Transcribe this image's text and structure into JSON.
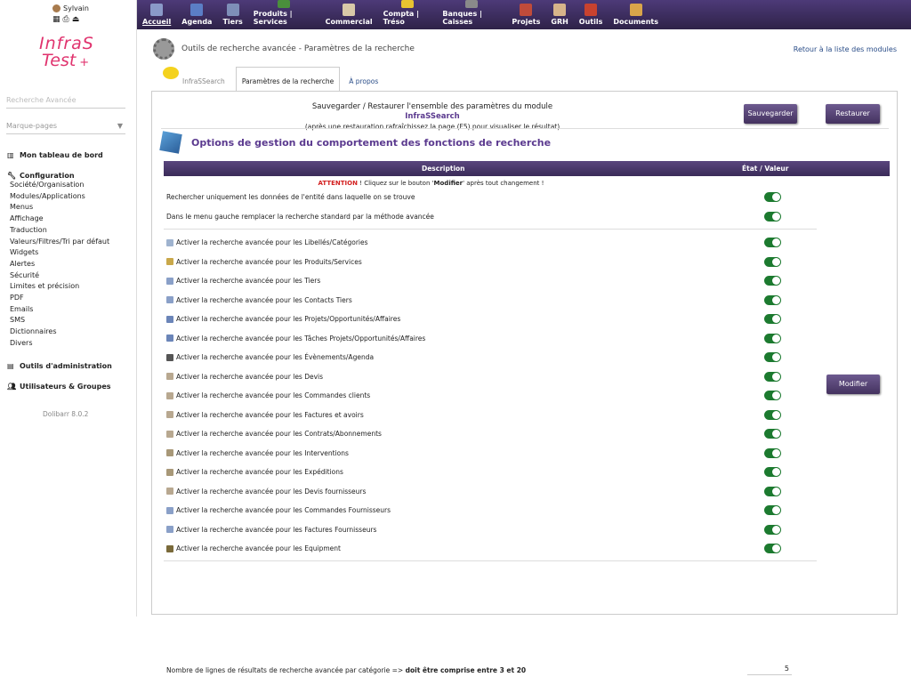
{
  "user": {
    "name": "Sylvain"
  },
  "logo": {
    "line1": "InfraS",
    "line2": "Test",
    "mark": "+"
  },
  "sidebar": {
    "search_placeholder": "Recherche Avancée",
    "bookmarks_placeholder": "Marque-pages",
    "dashboard": "Mon tableau de bord",
    "config_title": "Configuration",
    "config_items": [
      "Société/Organisation",
      "Modules/Applications",
      "Menus",
      "Affichage",
      "Traduction",
      "Valeurs/Filtres/Tri par défaut",
      "Widgets",
      "Alertes",
      "Sécurité",
      "Limites et précision",
      "PDF",
      "Emails",
      "SMS",
      "Dictionnaires",
      "Divers"
    ],
    "admin_tools": "Outils d'administration",
    "users_groups": "Utilisateurs & Groupes",
    "version": "Dolibarr 8.0.2"
  },
  "topmenu": [
    {
      "label": "Accueil",
      "color": "#8a9ac8"
    },
    {
      "label": "Agenda",
      "color": "#5b7ec6"
    },
    {
      "label": "Tiers",
      "color": "#7e8fb8"
    },
    {
      "label": "Produits | Services",
      "color": "#4a8f3c"
    },
    {
      "label": "Commercial",
      "color": "#d9c9a8"
    },
    {
      "label": "Compta | Tréso",
      "color": "#e8c330"
    },
    {
      "label": "Banques | Caisses",
      "color": "#8a8a8a"
    },
    {
      "label": "Projets",
      "color": "#c04b3a"
    },
    {
      "label": "GRH",
      "color": "#d7b48a"
    },
    {
      "label": "Outils",
      "color": "#c8422f"
    },
    {
      "label": "Documents",
      "color": "#d9a54a"
    }
  ],
  "page": {
    "title": "Outils de recherche avancée - Paramètres de la recherche",
    "back_link": "Retour à la liste des modules"
  },
  "tabs": [
    "InfraSSearch",
    "Paramètres de la recherche",
    "À propos"
  ],
  "savebar": {
    "line1_pre": "Sauvegarder / Restaurer l'ensemble des paramètres du module ",
    "module": "InfraSSearch",
    "line2": "(après une restauration rafraîchissez la page (F5) pour visualiser le résultat)",
    "save_label": "Sauvegarder",
    "restore_label": "Restaurer"
  },
  "section_title": "Options de gestion du comportement des fonctions de recherche",
  "table": {
    "col_desc": "Description",
    "col_state": "État / Valeur",
    "warn_label": "ATTENTION",
    "warn_pre": " ! Cliquez sur le bouton '",
    "warn_btn": "Modifier",
    "warn_post": "' après tout changement !",
    "general": [
      "Rechercher uniquement les données de l'entité dans laquelle on se trouve",
      "Dans le menu gauche remplacer la recherche standard par la méthode avancée"
    ],
    "items": [
      {
        "label": "Activer la recherche avancée pour les Libellés/Catégories",
        "icon": "#9fb3cf"
      },
      {
        "label": "Activer la recherche avancée pour les Produits/Services",
        "icon": "#c9a84a"
      },
      {
        "label": "Activer la recherche avancée pour les Tiers",
        "icon": "#8aa0c8"
      },
      {
        "label": "Activer la recherche avancée pour les Contacts Tiers",
        "icon": "#8aa0c8"
      },
      {
        "label": "Activer la recherche avancée pour les Projets/Opportunités/Affaires",
        "icon": "#6b85b8"
      },
      {
        "label": "Activer la recherche avancée pour les Tâches Projets/Opportunités/Affaires",
        "icon": "#6b85b8"
      },
      {
        "label": "Activer la recherche avancée pour les Évènements/Agenda",
        "icon": "#555555"
      },
      {
        "label": "Activer la recherche avancée pour les Devis",
        "icon": "#b8a890"
      },
      {
        "label": "Activer la recherche avancée pour les Commandes clients",
        "icon": "#b8a890"
      },
      {
        "label": "Activer la recherche avancée pour les Factures et avoirs",
        "icon": "#b8a890"
      },
      {
        "label": "Activer la recherche avancée pour les Contrats/Abonnements",
        "icon": "#b8a890"
      },
      {
        "label": "Activer la recherche avancée pour les Interventions",
        "icon": "#a89878"
      },
      {
        "label": "Activer la recherche avancée pour les Expéditions",
        "icon": "#a89878"
      },
      {
        "label": "Activer la recherche avancée pour les Devis fournisseurs",
        "icon": "#b8a890"
      },
      {
        "label": "Activer la recherche avancée pour les Commandes Fournisseurs",
        "icon": "#8aa0c8"
      },
      {
        "label": "Activer la recherche avancée pour les Factures Fournisseurs",
        "icon": "#8aa0c8"
      },
      {
        "label": "Activer la recherche avancée pour les Equipment",
        "icon": "#7a6a3a"
      }
    ],
    "modify_label": "Modifier",
    "footer_pre": "Nombre de lignes de résultats de recherche avancée par catégorie => ",
    "footer_bold": "doit être comprise entre 3 et 20",
    "footer_value": "5"
  }
}
